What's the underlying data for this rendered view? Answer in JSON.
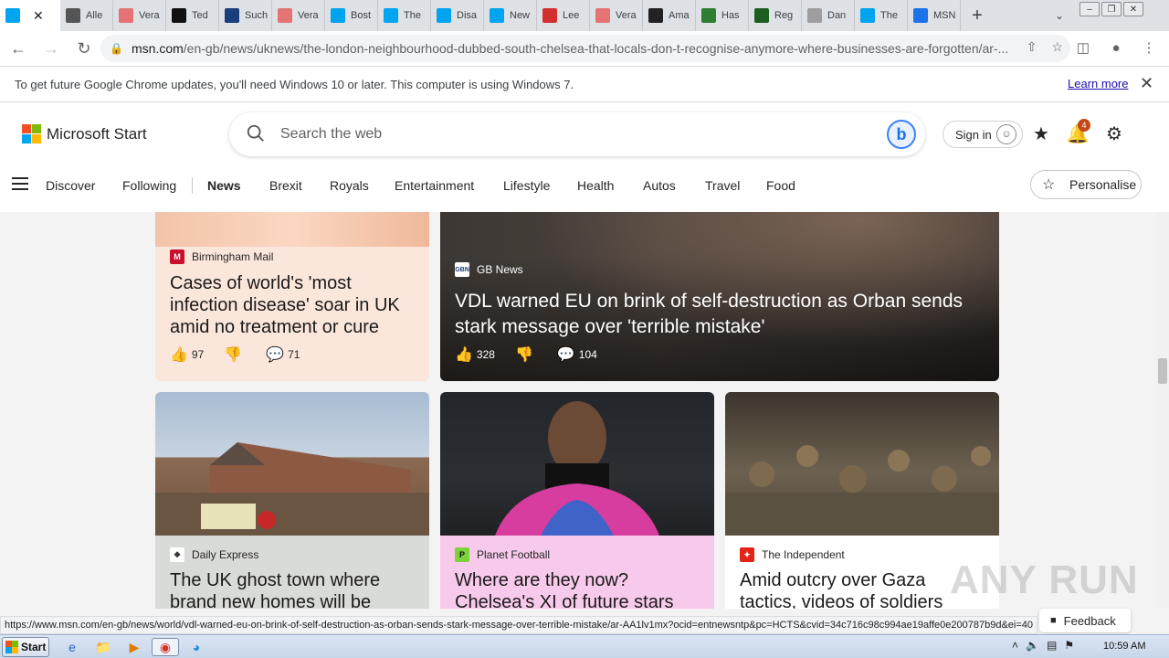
{
  "browser": {
    "tabs": [
      {
        "label": "",
        "color": "#00a4ef",
        "active": true
      },
      {
        "label": "Alle",
        "color": "#555555"
      },
      {
        "label": "Vera",
        "color": "#e57373"
      },
      {
        "label": "Ted",
        "color": "#111111"
      },
      {
        "label": "Such",
        "color": "#1a3d7c"
      },
      {
        "label": "Vera",
        "color": "#e57373"
      },
      {
        "label": "Bost",
        "color": "#00a4ef"
      },
      {
        "label": "The",
        "color": "#00a4ef"
      },
      {
        "label": "Disa",
        "color": "#00a4ef"
      },
      {
        "label": "New",
        "color": "#00a4ef"
      },
      {
        "label": "Lee",
        "color": "#d32f2f"
      },
      {
        "label": "Vera",
        "color": "#e57373"
      },
      {
        "label": "Ama",
        "color": "#222222"
      },
      {
        "label": "Has",
        "color": "#2e7d32"
      },
      {
        "label": "Reg",
        "color": "#1b5e20"
      },
      {
        "label": "Dan",
        "color": "#9e9e9e"
      },
      {
        "label": "The",
        "color": "#00a4ef"
      },
      {
        "label": "MSN",
        "color": "#1a73e8"
      }
    ],
    "url_host": "msn.com",
    "url_path": "/en-gb/news/uknews/the-london-neighbourhood-dubbed-south-chelsea-that-locals-don-t-recognise-anymore-where-businesses-are-forgotten/ar-...",
    "infobar_text": "To get future Google Chrome updates, you'll need Windows 10 or later. This computer is using Windows 7.",
    "infobar_link": "Learn more",
    "status_url": "https://www.msn.com/en-gb/news/world/vdl-warned-eu-on-brink-of-self-destruction-as-orban-sends-stark-message-over-terrible-mistake/ar-AA1lv1mx?ocid=entnewsntp&pc=HCTS&cvid=34c716c98c994ae19affe0e200787b9d&ei=40"
  },
  "msn": {
    "brand": "Microsoft Start",
    "search_placeholder": "Search the web",
    "signin": "Sign in",
    "notif_count": "4",
    "nav": [
      "Discover",
      "Following",
      "News",
      "Brexit",
      "Royals",
      "Entertainment",
      "Lifestyle",
      "Health",
      "Autos",
      "Travel",
      "Food"
    ],
    "personalise": "Personalise",
    "feedback": "Feedback"
  },
  "cards": [
    {
      "source": "Birmingham Mail",
      "headline": "Cases of world's 'most infection disease' soar in UK amid no treatment or cure",
      "likes": "97",
      "comments": "71",
      "bg": "#fbe6dc"
    },
    {
      "source": "GB News",
      "headline": "VDL warned EU on brink of self-destruction as Orban sends stark message over 'terrible mistake'",
      "likes": "328",
      "comments": "104",
      "bg": "#3a3633"
    },
    {
      "source": "Daily Express",
      "headline": "The UK ghost town where brand new homes will be",
      "bg": "#d9dbd8"
    },
    {
      "source": "Planet Football",
      "headline": "Where are they now? Chelsea's XI of future stars",
      "bg": "#f7c9ea"
    },
    {
      "source": "The Independent",
      "headline": "Amid outcry over Gaza tactics, videos of soldiers",
      "bg": "#ffffff"
    }
  ],
  "taskbar": {
    "start": "Start",
    "clock": "10:59 AM"
  },
  "watermark": "ANY RUN"
}
